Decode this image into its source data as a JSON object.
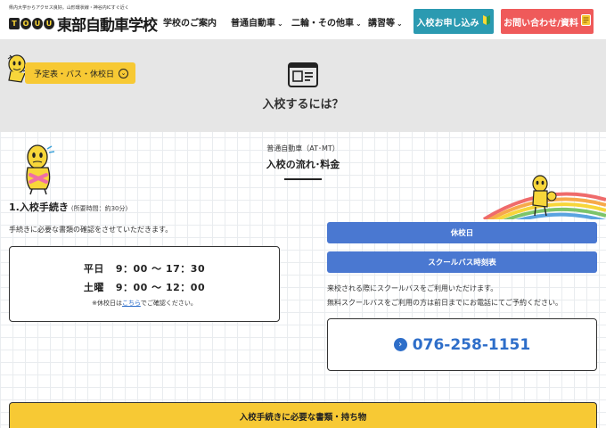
{
  "header": {
    "tagline": "県内大学からアクセス良好。山形環状線・神谷内ICすぐ近く",
    "logo_mark": [
      "T",
      "O",
      "U",
      "U"
    ],
    "logo_text": "東部自動車学校",
    "nav": [
      "学校のご案内",
      "普通自動車",
      "二輪・その他車",
      "講習等"
    ],
    "apply_button": "入校お申し込み",
    "contact_button": "お問い合わせ/資料"
  },
  "hero": {
    "schedule_button": "予定表・バス・休校日",
    "title": "入校するには？"
  },
  "section": {
    "eyebrow": "普通自動車（AT･MT）",
    "title": "入校の流れ･料金"
  },
  "step1": {
    "title": "1.入校手続き",
    "note": "(所要時間：約30分)",
    "description": "手続きに必要な書類の確認をさせていただきます。",
    "hours": [
      {
        "day": "平日",
        "time": "9：00 〜 17：30"
      },
      {
        "day": "土曜",
        "time": "9：00 〜 12：00"
      }
    ],
    "note_prefix": "※休校日は",
    "note_link": "こちら",
    "note_suffix": "でご確認ください。"
  },
  "side": {
    "holiday_button": "休校日",
    "bus_button": "スクールバス時刻表",
    "info_line1": "来校される際にスクールバスをご利用いただけます。",
    "info_line2": "無料スクールバスをご利用の方は前日までにお電話にてご予約ください。",
    "phone": "076-258-1151"
  },
  "documents_bar": "入校手続きに必要な書類・持ち物",
  "colors": {
    "accent_yellow": "#f7c934",
    "apply_teal": "#2b9ab1",
    "contact_red": "#ef5a5a",
    "button_blue": "#4a78d1",
    "phone_blue": "#2e6ec9"
  }
}
